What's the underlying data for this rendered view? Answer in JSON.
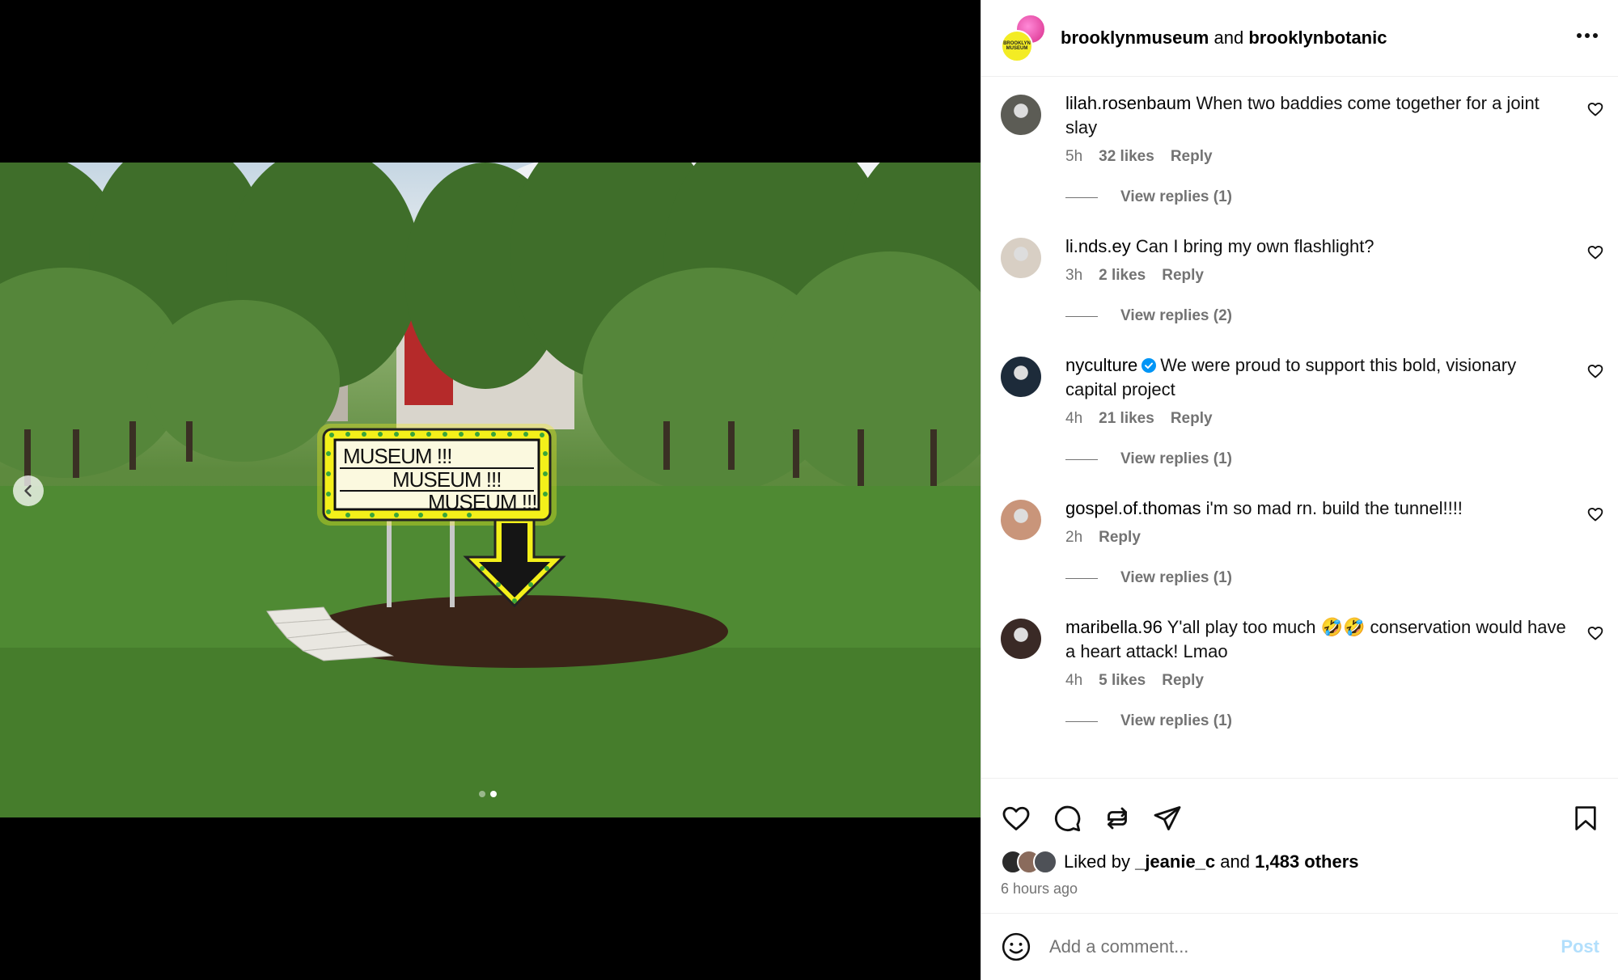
{
  "media": {
    "sign_lines": [
      "MUSEUM !!!",
      "MUSEUM !!!",
      "MUSEUM !!!"
    ],
    "slide_count": 2,
    "active_slide": 2
  },
  "header": {
    "account_1": "brooklynmuseum",
    "joiner": "and",
    "account_2": "brooklynbotanic",
    "avatar_text": "BROOKLYN MUSEUM"
  },
  "comments": [
    {
      "user": "lilah.rosenbaum",
      "text": "When two baddies come together for a joint slay",
      "time": "5h",
      "likes": "32 likes",
      "reply": "Reply",
      "view_replies": "View replies (1)",
      "avatar_color": "#5c5c55",
      "verified": false
    },
    {
      "user": "li.nds.ey",
      "text": "Can I bring my own flashlight?",
      "time": "3h",
      "likes": "2 likes",
      "reply": "Reply",
      "view_replies": "View replies (2)",
      "avatar_color": "#d8cfc4",
      "verified": false
    },
    {
      "user": "nyculture",
      "text": "We were proud to support this bold, visionary capital project",
      "time": "4h",
      "likes": "21 likes",
      "reply": "Reply",
      "view_replies": "View replies (1)",
      "avatar_color": "#1d2b3a",
      "verified": true
    },
    {
      "user": "gospel.of.thomas",
      "text": "i'm so mad rn. build the tunnel!!!!",
      "time": "2h",
      "likes": "",
      "reply": "Reply",
      "view_replies": "View replies (1)",
      "avatar_color": "#c9957a",
      "verified": false
    },
    {
      "user": "maribella.96",
      "text": "Y'all play too much 🤣🤣 conservation would have a heart attack! Lmao",
      "time": "4h",
      "likes": "5 likes",
      "reply": "Reply",
      "view_replies": "View replies (1)",
      "avatar_color": "#3a2a26",
      "verified": false
    }
  ],
  "likes": {
    "prefix": "Liked by",
    "user": "_jeanie_c",
    "joiner": "and",
    "others": "1,483 others"
  },
  "timestamp": "6 hours ago",
  "add_comment": {
    "placeholder": "Add a comment...",
    "post_label": "Post"
  },
  "colors": {
    "secondary_text": "#737373",
    "post_button_disabled": "#b2dffc",
    "verified_blue": "#0095f6",
    "sign_yellow": "#f4f01a"
  }
}
